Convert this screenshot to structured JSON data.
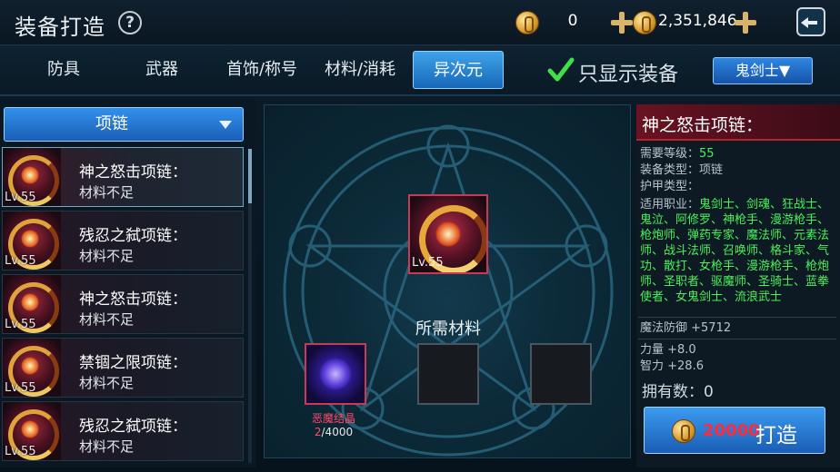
{
  "header": {
    "title": "装备打造",
    "gold_value": "0",
    "money_value": "2,351,846"
  },
  "tabs": [
    {
      "label": "防具",
      "active": false
    },
    {
      "label": "武器",
      "active": false
    },
    {
      "label": "首饰/称号",
      "active": false
    },
    {
      "label": "材料/消耗",
      "active": false
    },
    {
      "label": "异次元",
      "active": true
    }
  ],
  "filter": {
    "label": "只显示装备",
    "checked": true
  },
  "class_select": {
    "value": "鬼剑士▼"
  },
  "category_select": {
    "value": "项链"
  },
  "items": [
    {
      "name": "神之怒击项链：",
      "status": "材料不足",
      "level": "Lv.55",
      "selected": true
    },
    {
      "name": "残忍之弑项链：",
      "status": "材料不足",
      "level": "Lv.55",
      "selected": false
    },
    {
      "name": "神之怒击项链：",
      "status": "材料不足",
      "level": "Lv.55",
      "selected": false
    },
    {
      "name": "禁锢之限项链：",
      "status": "材料不足",
      "level": "Lv.55",
      "selected": false
    },
    {
      "name": "残忍之弑项链：",
      "status": "材料不足",
      "level": "Lv.55",
      "selected": false
    }
  ],
  "craft": {
    "item_level": "Lv.55",
    "materials_title": "所需材料",
    "material": {
      "name": "恶魔结晶",
      "have": "2",
      "need": "/4000"
    }
  },
  "detail": {
    "title": "神之怒击项链：",
    "req_level_label": "需要等级：",
    "req_level_value": "55",
    "type_label": "装备类型：",
    "type_value": "项链",
    "armor_label": "护甲类型：",
    "jobs_label": "适用职业：",
    "jobs_value": "鬼剑士、剑魂、狂战士、鬼泣、阿修罗、神枪手、漫游枪手、枪炮师、弹药专家、魔法师、元素法师、战斗法师、召唤师、格斗家、气功、散打、女枪手、漫游枪手、枪炮师、圣职者、驱魔师、圣骑士、蓝拳使者、女鬼剑士、流浪武士",
    "magic_def": "魔法防御 +5712",
    "strength": "力量 +8.0",
    "intelligence": "智力 +28.6",
    "owned": "拥有数：0",
    "forge_cost": "20000",
    "forge_label": "打造"
  },
  "colors": {
    "accent_blue": "#2a80dc",
    "req_green": "#4af05a",
    "shortage_red": "#ff4a6a",
    "title_red": "#6a1222"
  }
}
